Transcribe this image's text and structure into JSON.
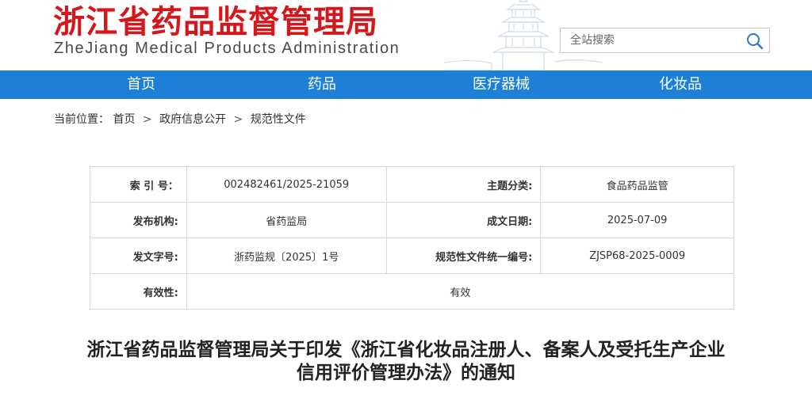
{
  "header": {
    "title_cn": "浙江省药品监督管理局",
    "title_en": "ZheJiang Medical Products Administration",
    "search_placeholder": "全站搜索"
  },
  "nav": {
    "items": [
      "首页",
      "药品",
      "医疗器械",
      "化妆品"
    ]
  },
  "breadcrumb": {
    "prefix": "当前位置：",
    "items": [
      "首页",
      "政府信息公开",
      "规范性文件"
    ],
    "separator": ">"
  },
  "meta": {
    "rows": [
      {
        "k1": "索 引 号：",
        "v1": "002482461/2025-21059",
        "k2": "主题分类:",
        "v2": "食品药品监管"
      },
      {
        "k1": "发布机构:",
        "v1": "省药监局",
        "k2": "成文日期:",
        "v2": "2025-07-09"
      },
      {
        "k1": "发文字号:",
        "v1": "浙药监规〔2025〕1号",
        "k2": "规范性文件统一编号:",
        "v2": "ZJSP68-2025-0009"
      }
    ],
    "validity_label": "有效性:",
    "validity_value": "有效"
  },
  "article": {
    "title_line1": "浙江省药品监督管理局关于印发《浙江省化妆品注册人、备案人及受托生产企业",
    "title_line2": "信用评价管理办法》的通知"
  },
  "colors": {
    "brand_red": "#d4171d",
    "nav_blue": "#1e7fd6"
  }
}
